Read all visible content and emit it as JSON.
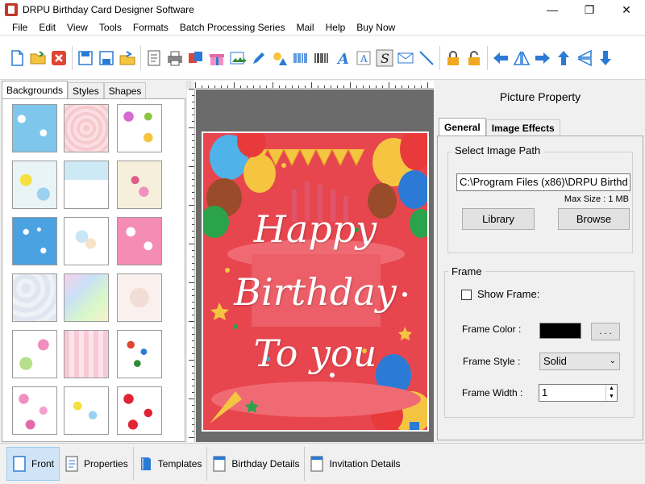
{
  "window": {
    "title": "DRPU Birthday Card Designer Software",
    "controls": {
      "minimize": "—",
      "maximize": "❐",
      "close": "✕"
    }
  },
  "menu": [
    "File",
    "Edit",
    "View",
    "Tools",
    "Formats",
    "Batch Processing Series",
    "Mail",
    "Help",
    "Buy Now"
  ],
  "left_panel": {
    "tabs": [
      "Backgrounds",
      "Styles",
      "Shapes"
    ],
    "active_tab": "Backgrounds"
  },
  "card": {
    "line1": "Happy",
    "line2": "Birthday",
    "line3": "To you"
  },
  "picture_property": {
    "title": "Picture Property",
    "tabs": [
      "General",
      "Image Effects"
    ],
    "image_path": {
      "group_title": "Select Image Path",
      "value": "C:\\Program Files (x86)\\DRPU Birthd",
      "max_size": "Max Size : 1 MB",
      "library_button": "Library",
      "browse_button": "Browse"
    },
    "frame": {
      "group_title": "Frame",
      "show_frame_label": "Show Frame:",
      "show_frame_checked": false,
      "frame_color_label": "Frame Color :",
      "frame_color": "#000000",
      "color_button": ". . .",
      "frame_style_label": "Frame Style :",
      "frame_style_value": "Solid",
      "frame_width_label": "Frame Width :",
      "frame_width_value": "1"
    }
  },
  "bottom_tabs": [
    "Front",
    "Properties",
    "Templates",
    "Birthday Details",
    "Invitation Details"
  ],
  "colors": {
    "card_bg": "#e8464e",
    "accent_blue": "#2b7bd6",
    "active_tab_bg": "#cfe4f7"
  }
}
